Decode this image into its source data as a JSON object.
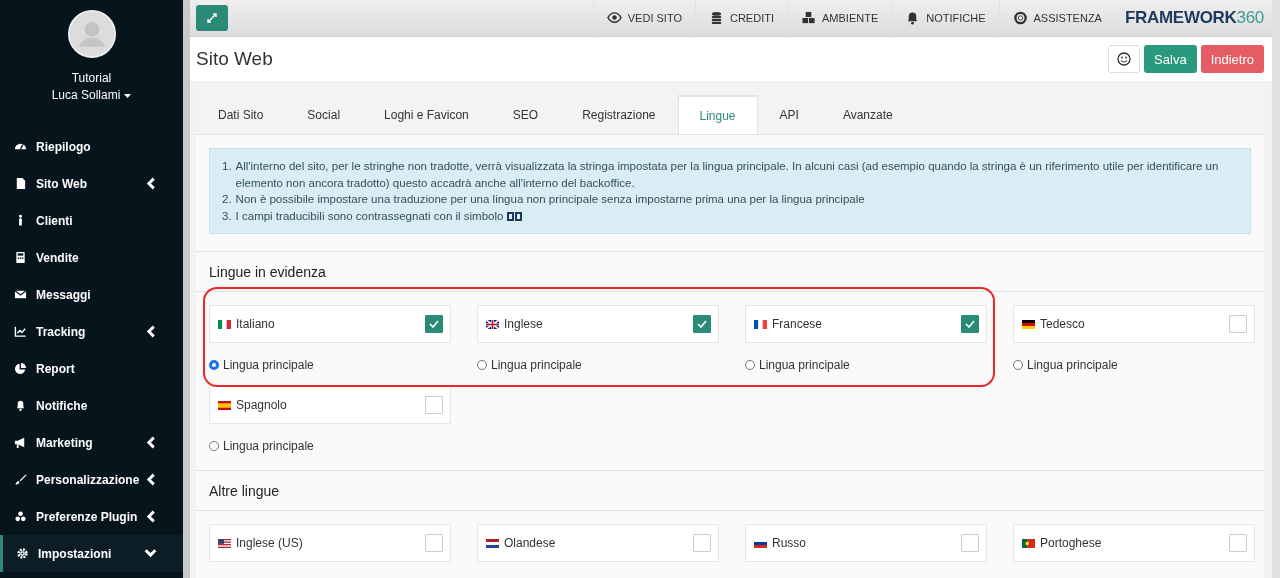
{
  "user": {
    "line1": "Tutorial",
    "line2": "Luca Sollami"
  },
  "sidebar": {
    "items": [
      {
        "label": "Riepilogo",
        "kind": "link",
        "selected": false
      },
      {
        "label": "Sito Web",
        "kind": "submenu",
        "expanded": false,
        "selected": false
      },
      {
        "label": "Clienti",
        "kind": "link",
        "selected": false
      },
      {
        "label": "Vendite",
        "kind": "link",
        "selected": false
      },
      {
        "label": "Messaggi",
        "kind": "link",
        "selected": false
      },
      {
        "label": "Tracking",
        "kind": "submenu",
        "expanded": false,
        "selected": false
      },
      {
        "label": "Report",
        "kind": "link",
        "selected": false
      },
      {
        "label": "Notifiche",
        "kind": "link",
        "selected": false
      },
      {
        "label": "Marketing",
        "kind": "submenu",
        "expanded": false,
        "selected": false
      },
      {
        "label": "Personalizzazione",
        "kind": "submenu",
        "expanded": false,
        "selected": false
      },
      {
        "label": "Preferenze Plugin",
        "kind": "submenu",
        "expanded": false,
        "selected": false
      },
      {
        "label": "Impostazioni",
        "kind": "submenu",
        "expanded": true,
        "selected": true
      }
    ]
  },
  "topbar": {
    "links": [
      "VEDI SITO",
      "CREDITI",
      "AMBIENTE",
      "NOTIFICHE",
      "ASSISTENZA"
    ],
    "logo": {
      "text": "FRAMEWORK",
      "number": "360"
    }
  },
  "page": {
    "title": "Sito Web",
    "buttons": [
      {
        "label": "Salva",
        "kind": "save"
      },
      {
        "label": "Indietro",
        "kind": "back"
      }
    ]
  },
  "tabs": [
    {
      "label": "Dati Sito",
      "selected": false
    },
    {
      "label": "Social",
      "selected": false
    },
    {
      "label": "Loghi e Favicon",
      "selected": false
    },
    {
      "label": "SEO",
      "selected": false
    },
    {
      "label": "Registrazione",
      "selected": false
    },
    {
      "label": "Lingue",
      "selected": true
    },
    {
      "label": "API",
      "selected": false
    },
    {
      "label": "Avanzate",
      "selected": false
    }
  ],
  "info": [
    {
      "number": "1.",
      "text": "All'interno del sito, per le stringhe non tradotte, verrà visualizzata la stringa impostata per la lingua principale. In alcuni casi (ad esempio quando la stringa è un riferimento utile per identificare un elemento non ancora tradotto) questo accadrà anche all'interno del backoffice."
    },
    {
      "number": "2.",
      "text": "Non è possibile impostare una traduzione per una lingua non principale senza impostarne prima una per la lingua principale"
    },
    {
      "number": "3.",
      "text": "I campi traducibili sono contrassegnati con il simbolo"
    }
  ],
  "featured": {
    "title": "Lingue in evidenza",
    "groups": [
      {
        "highlighted": true,
        "languages": [
          {
            "label": "Italiano",
            "kind": "it",
            "checked": true,
            "radio_label": "Lingua principale",
            "selected": true
          },
          {
            "label": "Inglese",
            "kind": "gb",
            "checked": true,
            "radio_label": "Lingua principale",
            "selected": false
          },
          {
            "label": "Francese",
            "kind": "fr",
            "checked": true,
            "radio_label": "Lingua principale",
            "selected": false
          }
        ]
      },
      {
        "highlighted": false,
        "languages": [
          {
            "label": "Tedesco",
            "kind": "de",
            "checked": false,
            "radio_label": "Lingua principale",
            "selected": false
          },
          {
            "label": "Spagnolo",
            "kind": "es",
            "checked": false,
            "radio_label": "Lingua principale",
            "selected": false
          }
        ]
      }
    ]
  },
  "other": {
    "title": "Altre lingue",
    "languages": [
      {
        "label": "Inglese (US)",
        "kind": "us",
        "checked": false
      },
      {
        "label": "Olandese",
        "kind": "nl",
        "checked": false
      },
      {
        "label": "Russo",
        "kind": "ru",
        "checked": false
      },
      {
        "label": "Portoghese",
        "kind": "pt",
        "checked": false
      }
    ]
  }
}
